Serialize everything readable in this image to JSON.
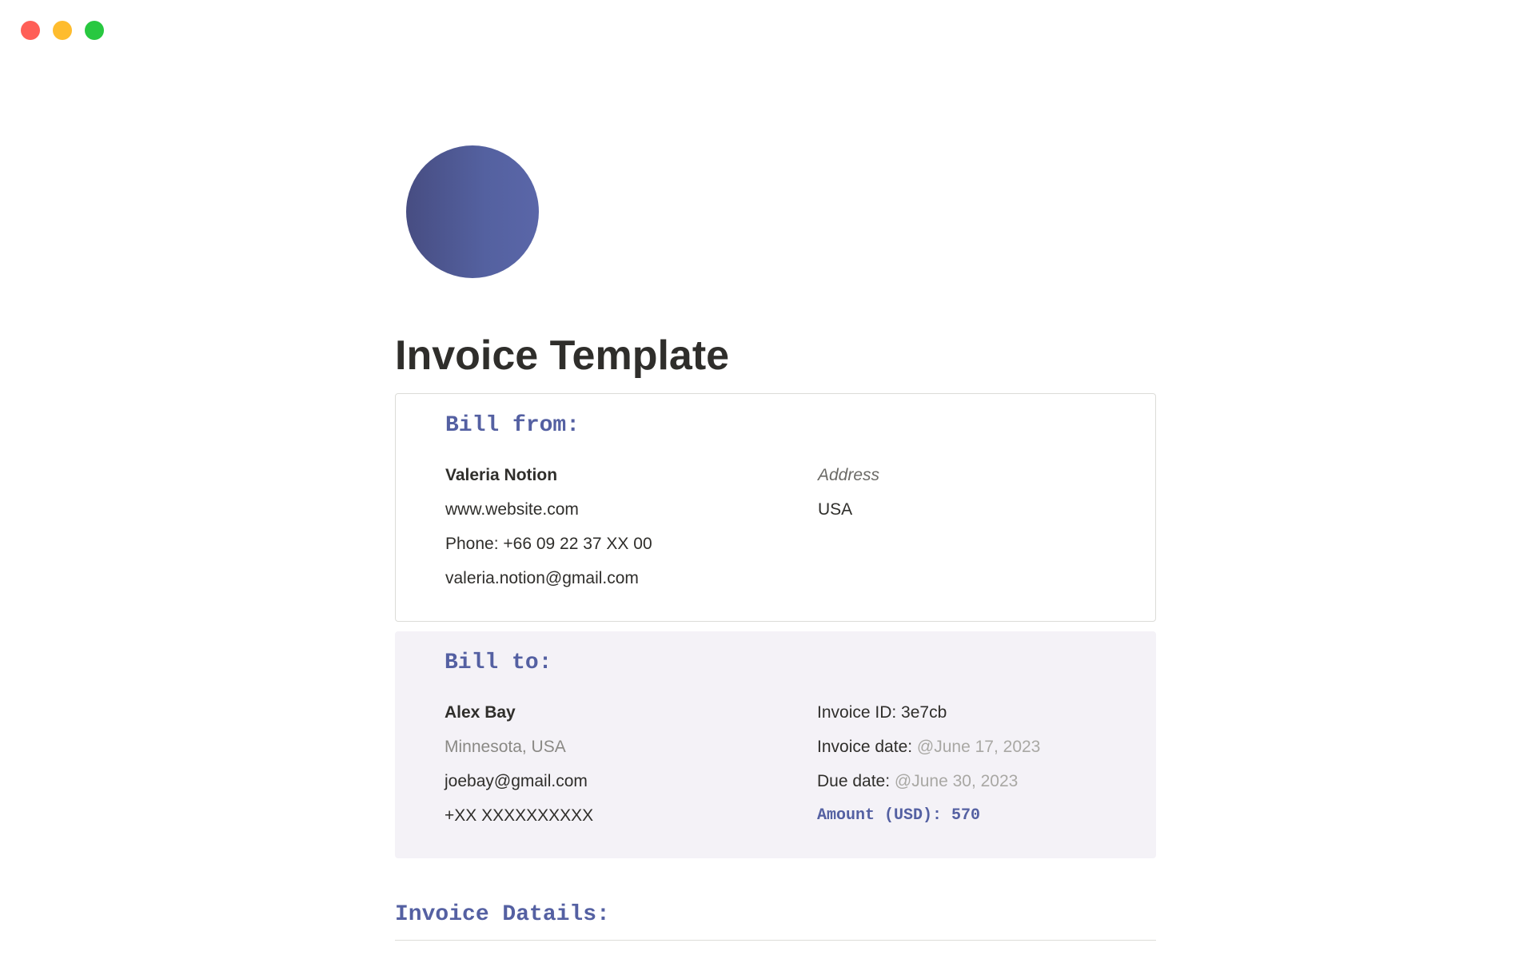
{
  "window": {
    "buttons": [
      {
        "name": "close",
        "color": "#ff5f57"
      },
      {
        "name": "minimize",
        "color": "#febc2e"
      },
      {
        "name": "maximize",
        "color": "#28c840"
      }
    ]
  },
  "page": {
    "icon": "gradient-circle-icon",
    "icon_colors": [
      "#474d82",
      "#5a66a8"
    ],
    "title": "Invoice Template"
  },
  "colors": {
    "accent": "#5460a2",
    "text": "#2f2e2b",
    "callout_bg": "#f4f2f7"
  },
  "bill_from": {
    "heading": "Bill from:",
    "name": "Valeria Notion",
    "website": "www.website.com",
    "phone": "Phone: +66 09 22 37 XX 00",
    "email": "valeria.notion@gmail.com",
    "address_label": "Address",
    "country": "USA"
  },
  "bill_to": {
    "heading": "Bill to:",
    "name": "Alex Bay",
    "location": "Minnesota, USA",
    "email": "joebay@gmail.com",
    "phone": "+XX XXXXXXXXXX",
    "invoice_id": "Invoice ID: 3e7cb",
    "invoice_date_label": "Invoice date: ",
    "invoice_date_value": "@June 17, 2023",
    "due_date_label": "Due date: ",
    "due_date_value": "@June 30, 2023",
    "amount": "Amount (USD): 570"
  },
  "invoice_details": {
    "heading": "Invoice Datails:"
  }
}
